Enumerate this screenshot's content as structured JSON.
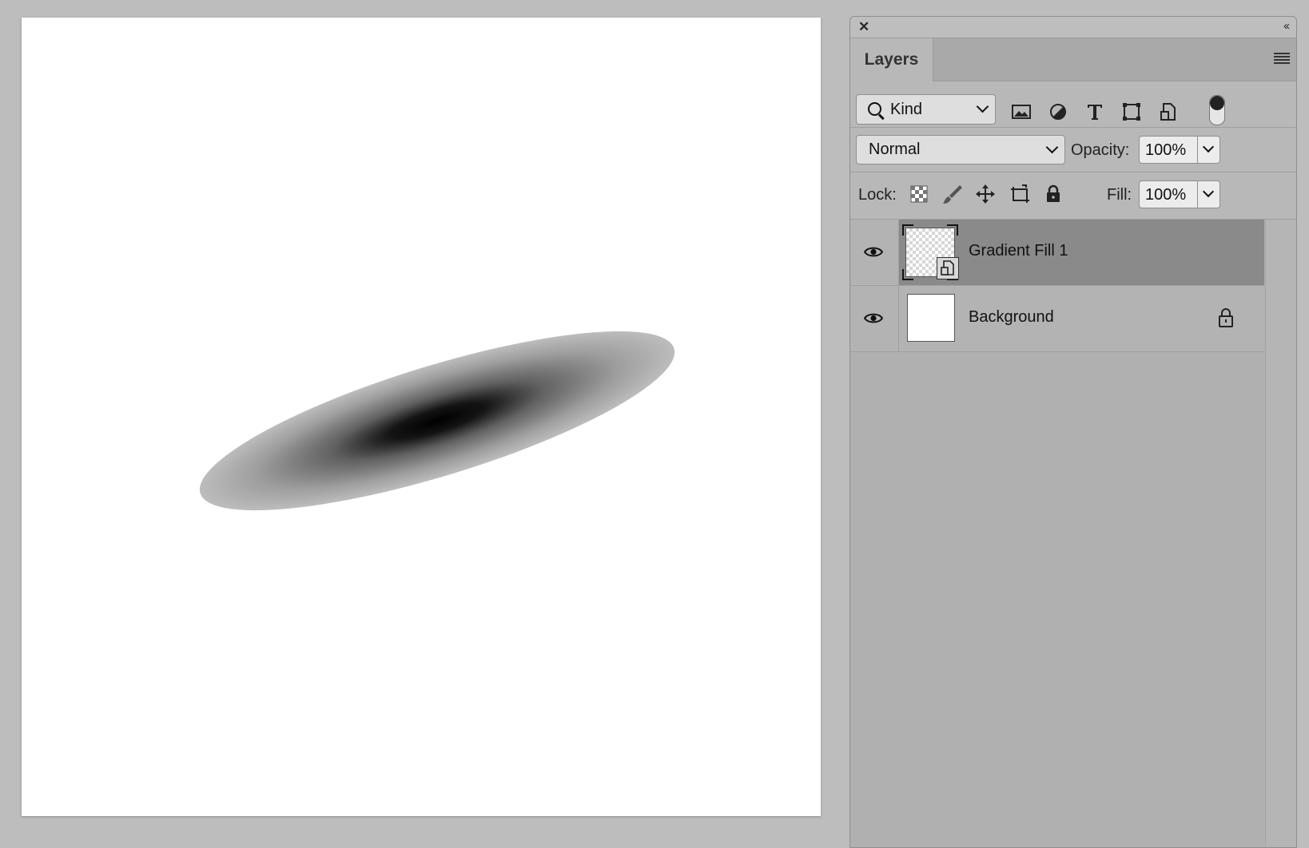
{
  "canvas": {
    "content": "gradient-blob"
  },
  "panel": {
    "close_glyph": "✕",
    "collapse_glyph": "‹‹",
    "tab_label": "Layers",
    "filter": {
      "kind_label": "Kind",
      "icons": [
        "image-filter-icon",
        "adjustment-filter-icon",
        "type-filter-icon",
        "shape-filter-icon",
        "smart-object-filter-icon"
      ]
    },
    "blend_mode": "Normal",
    "opacity_label": "Opacity:",
    "opacity_value": "100%",
    "lock_label": "Lock:",
    "fill_label": "Fill:",
    "fill_value": "100%",
    "layers": [
      {
        "name": "Gradient Fill 1",
        "selected": true,
        "visible": true,
        "locked": false
      },
      {
        "name": "Background",
        "selected": false,
        "visible": true,
        "locked": true
      }
    ]
  }
}
